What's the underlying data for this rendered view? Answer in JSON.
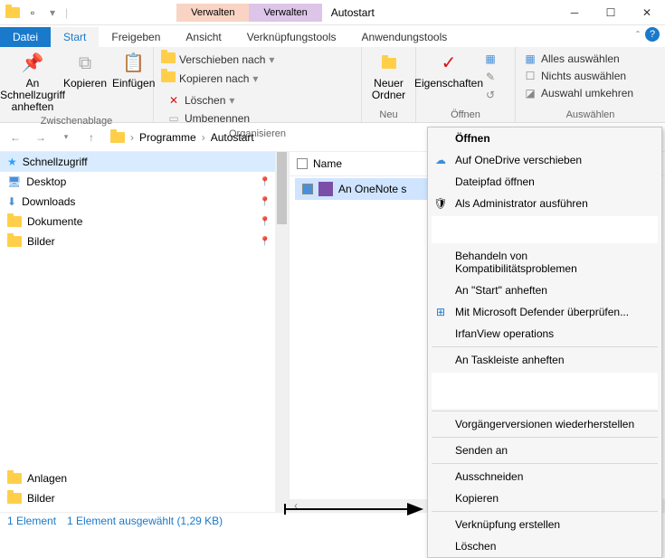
{
  "window": {
    "title": "Autostart",
    "verwalten1": "Verwalten",
    "verwalten2": "Verwalten"
  },
  "tabs": {
    "datei": "Datei",
    "start": "Start",
    "freigeben": "Freigeben",
    "ansicht": "Ansicht",
    "verk": "Verknüpfungstools",
    "anw": "Anwendungstools"
  },
  "ribbon": {
    "zwischen": {
      "label": "Zwischenablage",
      "pin": "An Schnellzugriff anheften",
      "copy": "Kopieren",
      "paste": "Einfügen"
    },
    "org": {
      "label": "Organisieren",
      "move": "Verschieben nach",
      "copyto": "Kopieren nach",
      "delete": "Löschen",
      "rename": "Umbenennen"
    },
    "neu": {
      "label": "Neu",
      "folder": "Neuer Ordner"
    },
    "offnen": {
      "label": "Öffnen",
      "props": "Eigenschaften"
    },
    "ausw": {
      "label": "Auswählen",
      "all": "Alles auswählen",
      "none": "Nichts auswählen",
      "invert": "Auswahl umkehren"
    }
  },
  "breadcrumb": {
    "p1": "Programme",
    "p2": "Autostart"
  },
  "sidebar": {
    "quick": "Schnellzugriff",
    "items": [
      "Desktop",
      "Downloads",
      "Dokumente",
      "Bilder"
    ],
    "bottom1": "Anlagen",
    "bottom2": "Bilder"
  },
  "filelist": {
    "col_name": "Name",
    "file1": "An OneNote s"
  },
  "status": {
    "count": "1 Element",
    "sel": "1 Element ausgewählt (1,29 KB)"
  },
  "ctx": {
    "open": "Öffnen",
    "onedrive": "Auf OneDrive verschieben",
    "path": "Dateipfad öffnen",
    "admin": "Als Administrator ausführen",
    "compat": "Behandeln von Kompatibilitätsproblemen",
    "startpin": "An \"Start\" anheften",
    "defender": "Mit Microsoft Defender überprüfen...",
    "irfan": "IrfanView operations",
    "taskbar": "An Taskleiste anheften",
    "prev": "Vorgängerversionen wiederherstellen",
    "sendto": "Senden an",
    "cut": "Ausschneiden",
    "copy": "Kopieren",
    "link": "Verknüpfung erstellen",
    "del": "Löschen"
  }
}
